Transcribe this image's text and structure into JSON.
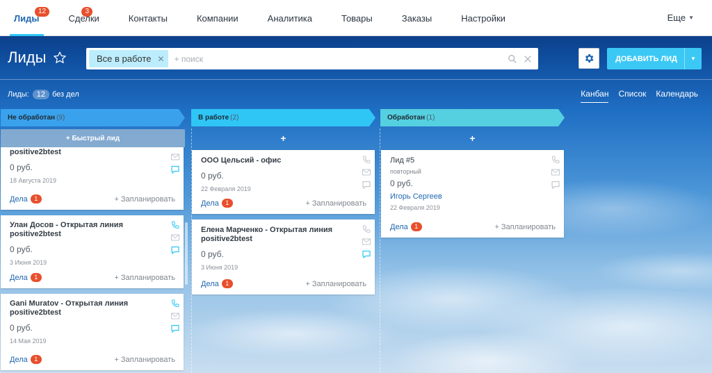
{
  "nav": {
    "tabs": [
      {
        "label": "Лиды",
        "badge": "12"
      },
      {
        "label": "Сделки",
        "badge": "3"
      },
      {
        "label": "Контакты"
      },
      {
        "label": "Компании"
      },
      {
        "label": "Аналитика"
      },
      {
        "label": "Товары"
      },
      {
        "label": "Заказы"
      },
      {
        "label": "Настройки"
      }
    ],
    "more": "Еще"
  },
  "header": {
    "title": "Лиды",
    "filter_chip": "Все в работе",
    "search_placeholder": "+ поиск",
    "add_button": "ДОБАВИТЬ ЛИД"
  },
  "counter": {
    "label": "Лиды:",
    "count": "12",
    "suffix": "без дел"
  },
  "views": [
    "Канбан",
    "Список",
    "Календарь"
  ],
  "columns": [
    {
      "title": "Не обработан",
      "count": "(9)",
      "color": "#3aa2ec",
      "add_label": "+ Быстрый лид",
      "cards": [
        {
          "title": "positive2btest",
          "amount": "0 руб.",
          "date": "18 Августа 2019",
          "deals": "Дела",
          "deals_count": "1",
          "plan": "+ Запланировать"
        },
        {
          "title": "Улан Досов - Открытая линия positive2btest",
          "amount": "0 руб.",
          "date": "3 Июня 2019",
          "deals": "Дела",
          "deals_count": "1",
          "plan": "+ Запланировать"
        },
        {
          "title": "Gani Muratov - Открытая линия positive2btest",
          "amount": "0 руб.",
          "date": "14 Мая 2019",
          "deals": "Дела",
          "deals_count": "1",
          "plan": "+ Запланировать"
        }
      ]
    },
    {
      "title": "В работе",
      "count": "(2)",
      "color": "#2fc6f6",
      "add_label": "+",
      "cards": [
        {
          "title": "ООО Цельсий - офис",
          "amount": "0 руб.",
          "date": "22 Февраля 2019",
          "deals": "Дела",
          "deals_count": "1",
          "plan": "+ Запланировать"
        },
        {
          "title": "Елена Марченко - Открытая линия positive2btest",
          "amount": "0 руб.",
          "date": "3 Июня 2019",
          "deals": "Дела",
          "deals_count": "1",
          "plan": "+ Запланировать"
        }
      ]
    },
    {
      "title": "Обработан",
      "count": "(1)",
      "color": "#55d0e0",
      "add_label": "+",
      "cards": [
        {
          "title": "Лид #5",
          "sub": "повторный",
          "amount": "0 руб.",
          "person": "Игорь Сергеев",
          "date": "22 Февраля 2019",
          "deals": "Дела",
          "deals_count": "1",
          "plan": "+ Запланировать"
        }
      ]
    }
  ],
  "colors": {
    "accent": "#3bc8f5",
    "badge": "#e84f2c",
    "link": "#2067b0"
  }
}
